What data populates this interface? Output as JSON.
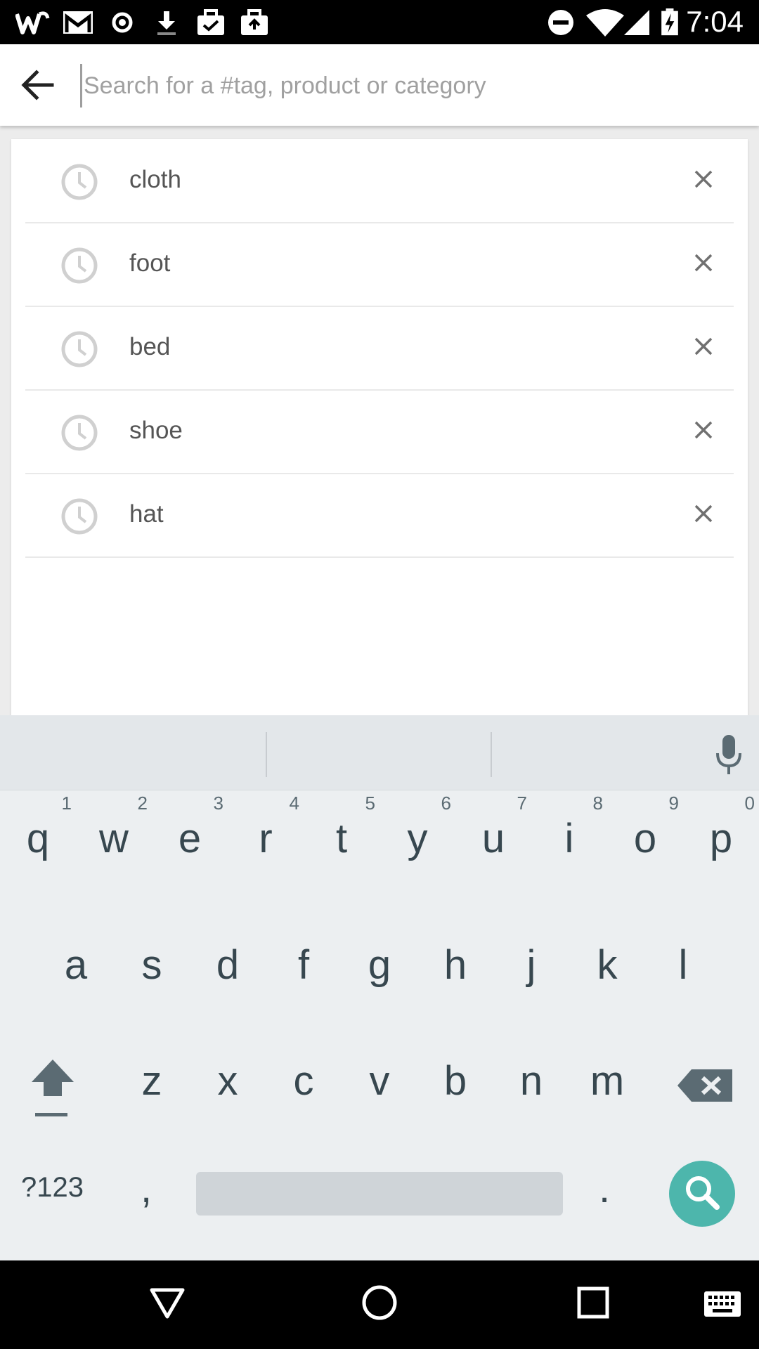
{
  "status_bar": {
    "time": "7:04",
    "left_icons": [
      "wish-app-icon",
      "gmail-icon",
      "sync-icon",
      "download-icon",
      "work-bag-icon",
      "work-bag-icon"
    ],
    "right_icons": [
      "do-not-disturb-icon",
      "wifi-icon",
      "signal-icon",
      "battery-charging-icon"
    ]
  },
  "search": {
    "placeholder": "Search for a #tag, product or category",
    "value": ""
  },
  "recent_searches": [
    "cloth",
    "foot",
    "bed",
    "shoe",
    "hat"
  ],
  "keyboard": {
    "row1": [
      {
        "ch": "q",
        "hint": "1"
      },
      {
        "ch": "w",
        "hint": "2"
      },
      {
        "ch": "e",
        "hint": "3"
      },
      {
        "ch": "r",
        "hint": "4"
      },
      {
        "ch": "t",
        "hint": "5"
      },
      {
        "ch": "y",
        "hint": "6"
      },
      {
        "ch": "u",
        "hint": "7"
      },
      {
        "ch": "i",
        "hint": "8"
      },
      {
        "ch": "o",
        "hint": "9"
      },
      {
        "ch": "p",
        "hint": "0"
      }
    ],
    "row2": [
      "a",
      "s",
      "d",
      "f",
      "g",
      "h",
      "j",
      "k",
      "l"
    ],
    "row3": [
      "z",
      "x",
      "c",
      "v",
      "b",
      "n",
      "m"
    ],
    "symbols_label": "?123",
    "comma": ",",
    "period": "."
  },
  "colors": {
    "accent": "#4db6ac",
    "keyboard_bg": "#eceff1",
    "key_text": "#37474f"
  }
}
